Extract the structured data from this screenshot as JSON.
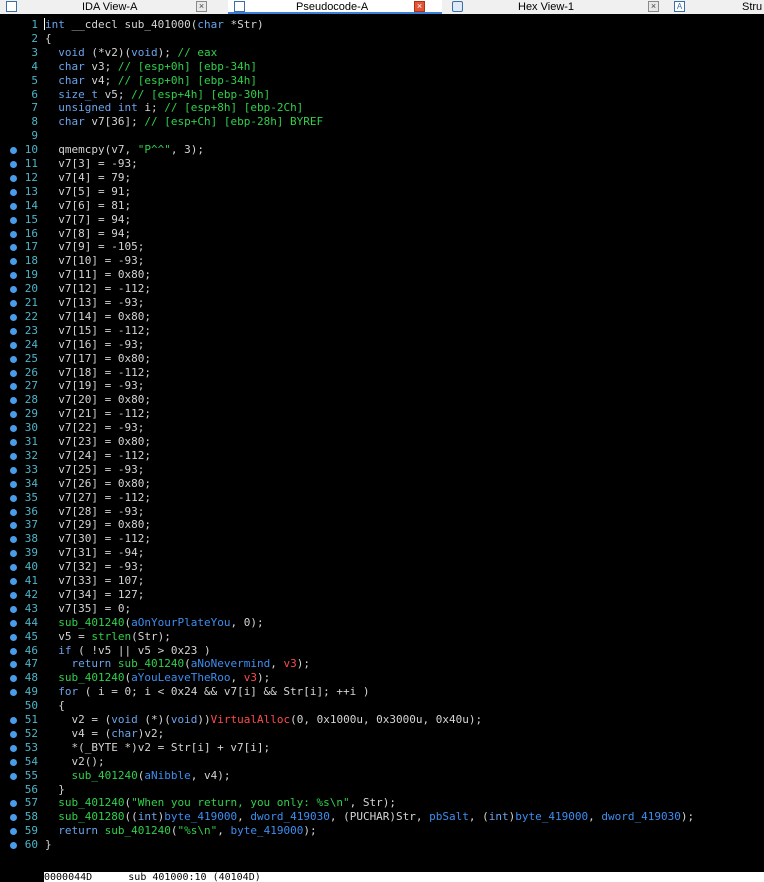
{
  "tabs": [
    {
      "label": "IDA View-A",
      "icon": "listing-icon",
      "active": false
    },
    {
      "label": "Pseudocode-A",
      "icon": "listing-icon",
      "active": true
    },
    {
      "label": "Hex View-1",
      "icon": "hex-icon",
      "active": false
    },
    {
      "label": "Stru",
      "icon": "struct-icon",
      "active": false
    }
  ],
  "code_lines": [
    [
      [
        "t",
        "int __cdecl sub_401000(char *Str)"
      ]
    ],
    [
      [
        "t",
        "{"
      ]
    ],
    [
      [
        "t",
        "  void (*v2)(void); "
      ],
      [
        "cm",
        "// eax"
      ]
    ],
    [
      [
        "t",
        "  char v3; "
      ],
      [
        "cm",
        "// [esp+0h] [ebp-34h]"
      ]
    ],
    [
      [
        "t",
        "  char v4; "
      ],
      [
        "cm",
        "// [esp+0h] [ebp-34h]"
      ]
    ],
    [
      [
        "t",
        "  size_t v5; "
      ],
      [
        "cm",
        "// [esp+4h] [ebp-30h]"
      ]
    ],
    [
      [
        "t",
        "  unsigned int i; "
      ],
      [
        "cm",
        "// [esp+8h] [ebp-2Ch]"
      ]
    ],
    [
      [
        "t",
        "  char v7[36]; "
      ],
      [
        "cm",
        "// [esp+Ch] [ebp-28h] BYREF"
      ]
    ],
    [
      [
        "t",
        ""
      ]
    ],
    [
      [
        "t",
        "  qmemcpy(v7, "
      ],
      [
        "st",
        "\"P^^\""
      ],
      [
        "t",
        ", 3);"
      ]
    ],
    [
      [
        "t",
        "  v7[3] = -93;"
      ]
    ],
    [
      [
        "t",
        "  v7[4] = 79;"
      ]
    ],
    [
      [
        "t",
        "  v7[5] = 91;"
      ]
    ],
    [
      [
        "t",
        "  v7[6] = 81;"
      ]
    ],
    [
      [
        "t",
        "  v7[7] = 94;"
      ]
    ],
    [
      [
        "t",
        "  v7[8] = 94;"
      ]
    ],
    [
      [
        "t",
        "  v7[9] = -105;"
      ]
    ],
    [
      [
        "t",
        "  v7[10] = -93;"
      ]
    ],
    [
      [
        "t",
        "  v7[11] = 0x80;"
      ]
    ],
    [
      [
        "t",
        "  v7[12] = -112;"
      ]
    ],
    [
      [
        "t",
        "  v7[13] = -93;"
      ]
    ],
    [
      [
        "t",
        "  v7[14] = 0x80;"
      ]
    ],
    [
      [
        "t",
        "  v7[15] = -112;"
      ]
    ],
    [
      [
        "t",
        "  v7[16] = -93;"
      ]
    ],
    [
      [
        "t",
        "  v7[17] = 0x80;"
      ]
    ],
    [
      [
        "t",
        "  v7[18] = -112;"
      ]
    ],
    [
      [
        "t",
        "  v7[19] = -93;"
      ]
    ],
    [
      [
        "t",
        "  v7[20] = 0x80;"
      ]
    ],
    [
      [
        "t",
        "  v7[21] = -112;"
      ]
    ],
    [
      [
        "t",
        "  v7[22] = -93;"
      ]
    ],
    [
      [
        "t",
        "  v7[23] = 0x80;"
      ]
    ],
    [
      [
        "t",
        "  v7[24] = -112;"
      ]
    ],
    [
      [
        "t",
        "  v7[25] = -93;"
      ]
    ],
    [
      [
        "t",
        "  v7[26] = 0x80;"
      ]
    ],
    [
      [
        "t",
        "  v7[27] = -112;"
      ]
    ],
    [
      [
        "t",
        "  v7[28] = -93;"
      ]
    ],
    [
      [
        "t",
        "  v7[29] = 0x80;"
      ]
    ],
    [
      [
        "t",
        "  v7[30] = -112;"
      ]
    ],
    [
      [
        "t",
        "  v7[31] = -94;"
      ]
    ],
    [
      [
        "t",
        "  v7[32] = -93;"
      ]
    ],
    [
      [
        "t",
        "  v7[33] = 107;"
      ]
    ],
    [
      [
        "t",
        "  v7[34] = 127;"
      ]
    ],
    [
      [
        "t",
        "  v7[35] = 0;"
      ]
    ],
    [
      [
        "t",
        "  "
      ],
      [
        "fn",
        "sub_401240"
      ],
      [
        "t",
        "("
      ],
      [
        "gv",
        "aOnYourPlateYou"
      ],
      [
        "t",
        ", 0);"
      ]
    ],
    [
      [
        "t",
        "  v5 = "
      ],
      [
        "fn",
        "strlen"
      ],
      [
        "t",
        "(Str);"
      ]
    ],
    [
      [
        "t",
        "  if ( !v5 || v5 > 0x23 )"
      ]
    ],
    [
      [
        "t",
        "    return "
      ],
      [
        "fn",
        "sub_401240"
      ],
      [
        "t",
        "("
      ],
      [
        "gv",
        "aNoNevermind"
      ],
      [
        "t",
        ", "
      ],
      [
        "im",
        "v3"
      ],
      [
        "t",
        ");"
      ]
    ],
    [
      [
        "t",
        "  "
      ],
      [
        "fn",
        "sub_401240"
      ],
      [
        "t",
        "("
      ],
      [
        "gv",
        "aYouLeaveTheRoo"
      ],
      [
        "t",
        ", "
      ],
      [
        "im",
        "v3"
      ],
      [
        "t",
        ");"
      ]
    ],
    [
      [
        "t",
        "  for ( i = 0; i < 0x24 && v7[i] && Str[i]; ++i )"
      ]
    ],
    [
      [
        "t",
        "  {"
      ]
    ],
    [
      [
        "t",
        "    v2 = (void (*)(void))"
      ],
      [
        "im",
        "VirtualAlloc"
      ],
      [
        "t",
        "(0, 0x1000u, 0x3000u, 0x40u);"
      ]
    ],
    [
      [
        "t",
        "    v4 = (char)v2;"
      ]
    ],
    [
      [
        "t",
        "    *(_BYTE *)v2 = Str[i] + v7[i];"
      ]
    ],
    [
      [
        "t",
        "    v2();"
      ]
    ],
    [
      [
        "t",
        "    "
      ],
      [
        "fn",
        "sub_401240"
      ],
      [
        "t",
        "("
      ],
      [
        "gv",
        "aNibble"
      ],
      [
        "t",
        ", v4);"
      ]
    ],
    [
      [
        "t",
        "  }"
      ]
    ],
    [
      [
        "t",
        "  "
      ],
      [
        "fn",
        "sub_401240"
      ],
      [
        "t",
        "("
      ],
      [
        "st",
        "\"When you return, you only: %s\\n\""
      ],
      [
        "t",
        ", Str);"
      ]
    ],
    [
      [
        "t",
        "  "
      ],
      [
        "fn",
        "sub_401280"
      ],
      [
        "t",
        "((int)"
      ],
      [
        "gv",
        "byte_419000"
      ],
      [
        "t",
        ", "
      ],
      [
        "gv",
        "dword_419030"
      ],
      [
        "t",
        ", (PUCHAR)Str, "
      ],
      [
        "gv",
        "pbSalt"
      ],
      [
        "t",
        ", (int)"
      ],
      [
        "gv",
        "byte_419000"
      ],
      [
        "t",
        ", "
      ],
      [
        "gv",
        "dword_419030"
      ],
      [
        "t",
        ");"
      ]
    ],
    [
      [
        "t",
        "  return "
      ],
      [
        "fn",
        "sub_401240"
      ],
      [
        "t",
        "("
      ],
      [
        "st",
        "\"%s\\n\""
      ],
      [
        "t",
        ", "
      ],
      [
        "gv",
        "byte_419000"
      ],
      [
        "t",
        ");"
      ]
    ],
    [
      [
        "t",
        "}"
      ]
    ]
  ],
  "breakpoint_lines": [
    10,
    11,
    12,
    13,
    14,
    15,
    16,
    17,
    18,
    19,
    20,
    21,
    22,
    23,
    24,
    25,
    26,
    27,
    28,
    29,
    30,
    31,
    32,
    33,
    34,
    35,
    36,
    37,
    38,
    39,
    40,
    41,
    42,
    43,
    44,
    45,
    46,
    47,
    48,
    49,
    51,
    52,
    53,
    54,
    55,
    57,
    58,
    59,
    60
  ],
  "status_bar": "0000044D      sub_401000:10 (40104D)"
}
